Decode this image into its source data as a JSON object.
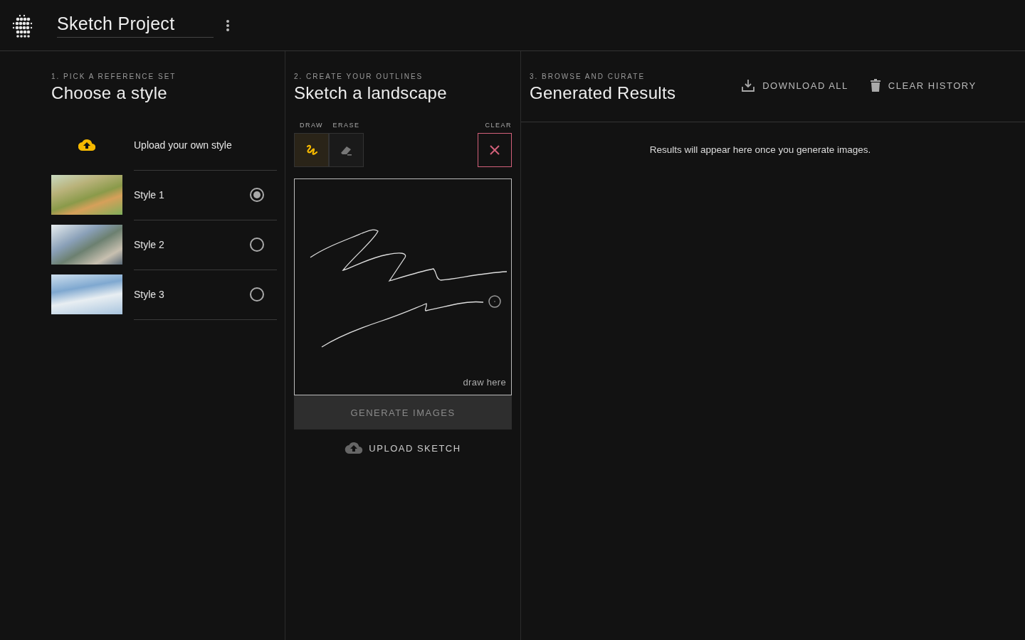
{
  "app": {
    "title": "Sketch Project"
  },
  "style_panel": {
    "step": "1. PICK A REFERENCE SET",
    "heading": "Choose a style",
    "upload_label": "Upload your own style",
    "styles": [
      {
        "label": "Style 1",
        "selected": true
      },
      {
        "label": "Style 2",
        "selected": false
      },
      {
        "label": "Style 3",
        "selected": false
      }
    ]
  },
  "sketch_panel": {
    "step": "2. CREATE YOUR OUTLINES",
    "heading": "Sketch a landscape",
    "tools": [
      {
        "kind": "draw",
        "label": "DRAW",
        "selected": true
      },
      {
        "kind": "erase",
        "label": "ERASE",
        "selected": false
      }
    ],
    "clear_label": "CLEAR",
    "canvas_hint": "draw here",
    "generate_button": {
      "label": "GENERATE IMAGES",
      "disabled": true
    },
    "upload_button": "UPLOAD SKETCH"
  },
  "results_panel": {
    "step": "3. BROWSE AND CURATE",
    "heading": "Generated Results",
    "actions": [
      {
        "kind": "download",
        "label": "DOWNLOAD ALL"
      },
      {
        "kind": "clear",
        "label": "CLEAR HISTORY"
      }
    ],
    "empty_message": "Results will appear here once you generate images."
  }
}
